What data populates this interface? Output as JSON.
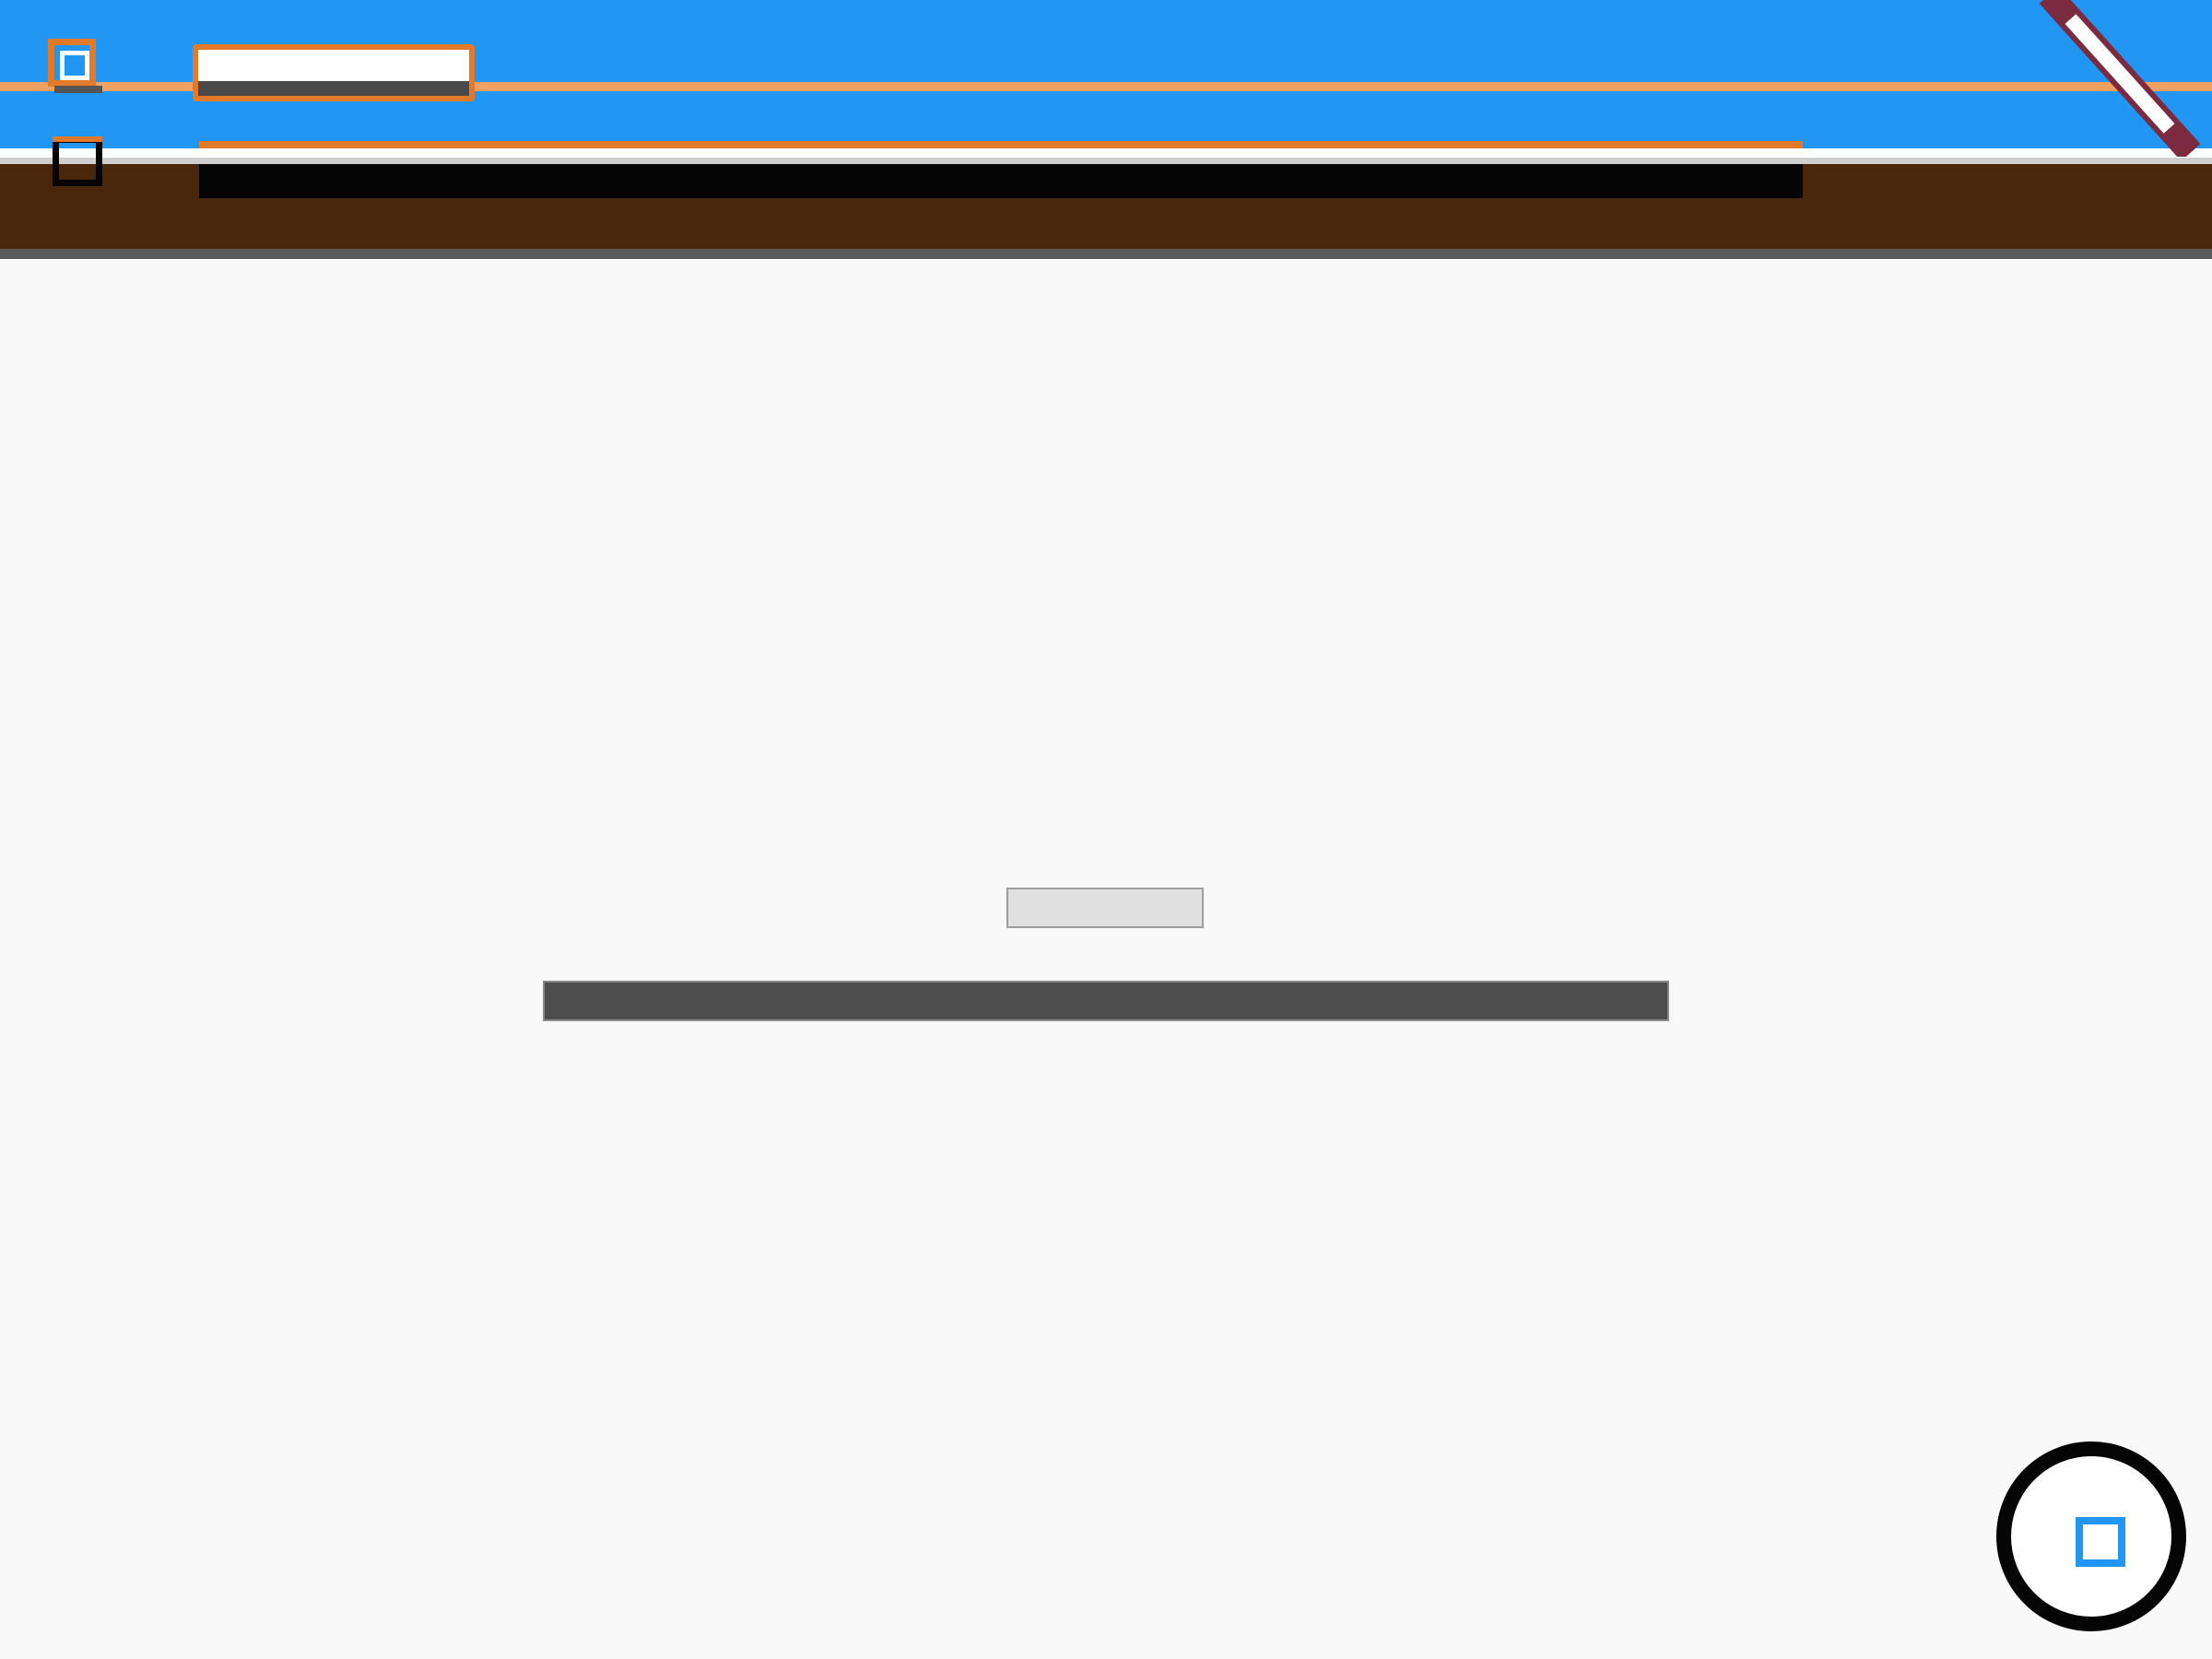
{
  "header": {
    "title_value": "",
    "toolbar_text": ""
  },
  "main": {
    "chip_label": "",
    "message_text": ""
  },
  "colors": {
    "app_bar": "#2196f3",
    "accent": "#e37a2a",
    "header_dark": "#4a260b",
    "edit_icon_tips": "#7b2a40",
    "background": "#f9f9f9",
    "message_bar": "#4d4d4d"
  },
  "icons": {
    "menu": "menu-square-icon",
    "toggle": "toggle-square-icon",
    "edit": "pencil-icon",
    "fab": "square-icon"
  }
}
